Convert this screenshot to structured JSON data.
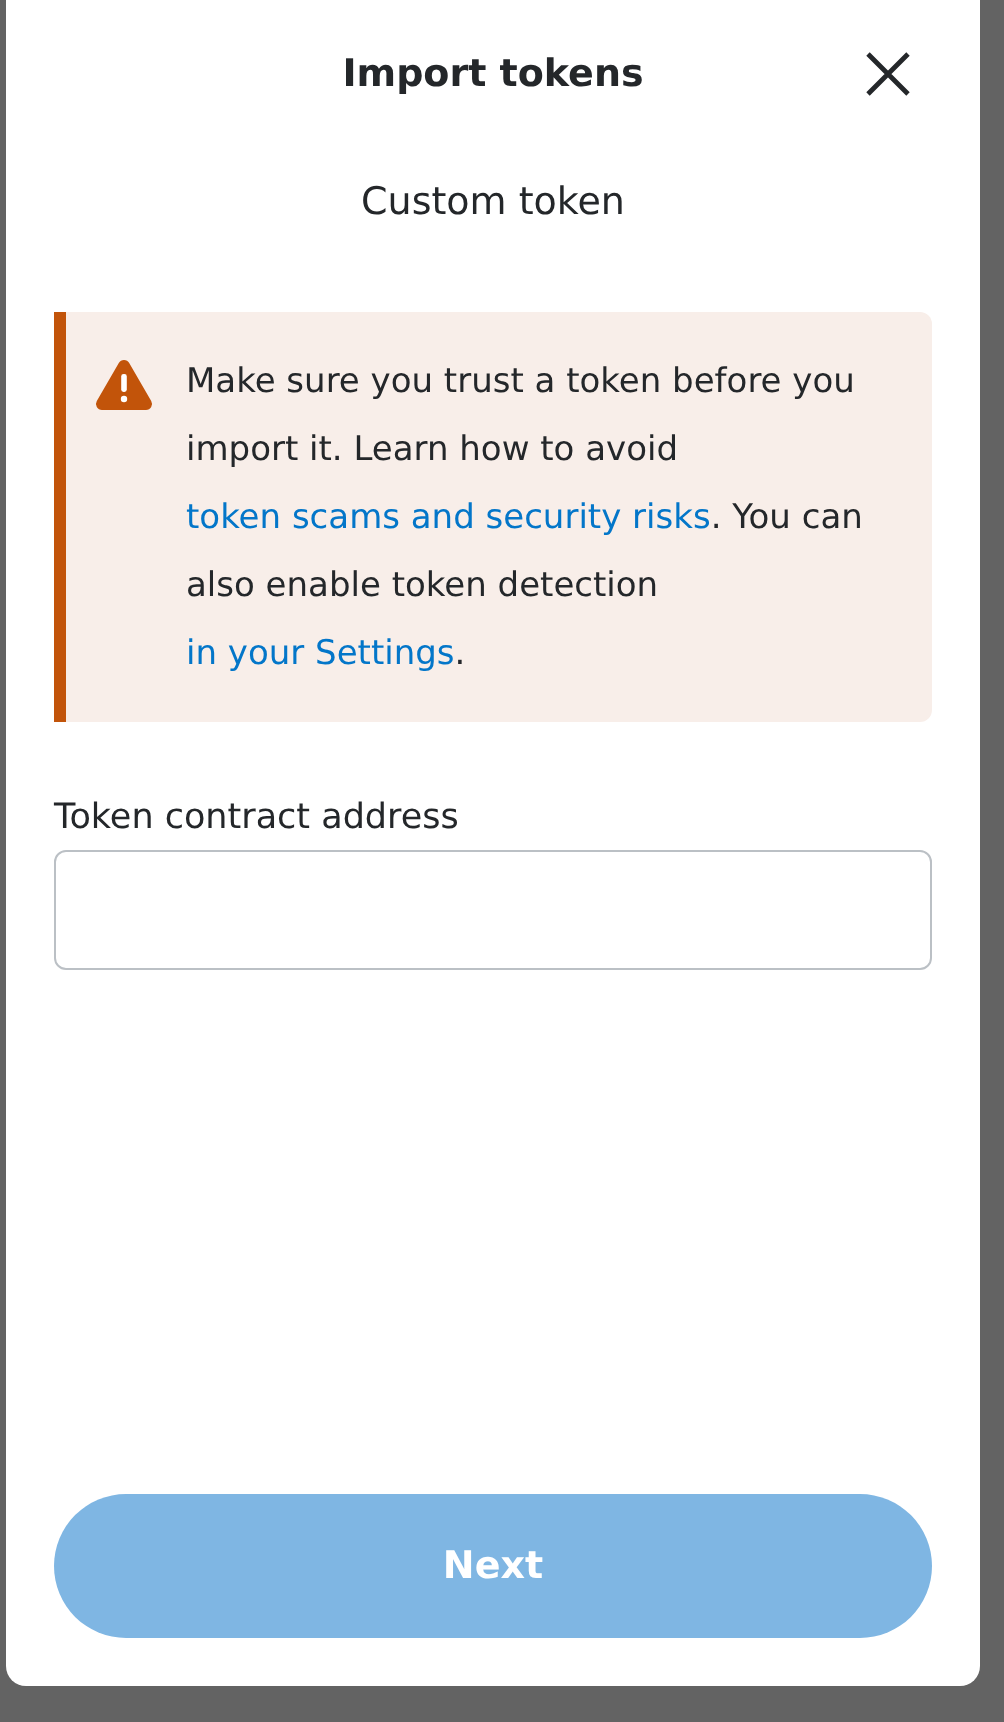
{
  "dialog": {
    "title": "Import tokens"
  },
  "section_title": "Custom token",
  "alert": {
    "kind": "warning",
    "text": "Make sure you trust a token before you import it. Learn how to avoid ",
    "link1": "token scams and security risks",
    "text2": ". You can also enable token detection ",
    "link2": "in your Settings",
    "text3": "."
  },
  "field": {
    "label": "Token contract address"
  },
  "next_button": {
    "label": "Next",
    "disabled": true
  }
}
